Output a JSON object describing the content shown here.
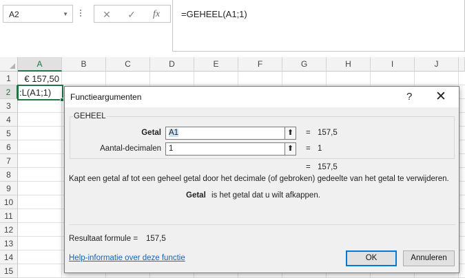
{
  "formula_bar": {
    "name_box": "A2",
    "cancel_icon": "✕",
    "enter_icon": "✓",
    "fx_label": "fx",
    "formula": "=GEHEEL(A1;1)"
  },
  "sheet": {
    "columns": [
      "A",
      "B",
      "C",
      "D",
      "E",
      "F",
      "G",
      "H",
      "I",
      "J"
    ],
    "rows": [
      "1",
      "2",
      "3",
      "4",
      "5",
      "6",
      "7",
      "8",
      "9",
      "10",
      "11",
      "12",
      "13",
      "14",
      "15"
    ],
    "selected_column": "A",
    "selected_row": "2",
    "cells": {
      "A1": "€ 157,50",
      "A2": ":L(A1;1)"
    }
  },
  "dialog": {
    "title": "Functieargumenten",
    "help_icon": "?",
    "close_icon": "✕",
    "function_name": "GEHEEL",
    "arguments": [
      {
        "label": "Getal",
        "value": "A1",
        "result": "157,5"
      },
      {
        "label": "Aantal-decimalen",
        "value": "1",
        "result": "1"
      }
    ],
    "equals": "=",
    "function_result": "157,5",
    "description": "Kapt een getal af tot een geheel getal door het decimale (of gebroken) gedeelte van het getal te verwijderen.",
    "arg_description_name": "Getal",
    "arg_description_text": "is het getal dat u wilt afkappen.",
    "result_label": "Resultaat formule =",
    "result_value": "157,5",
    "help_link": "Help-informatie over deze functie",
    "ok_label": "OK",
    "cancel_label": "Annuleren"
  },
  "colors": {
    "excel_green": "#217346",
    "link_blue": "#1664b4",
    "focus_blue": "#0078d7"
  }
}
